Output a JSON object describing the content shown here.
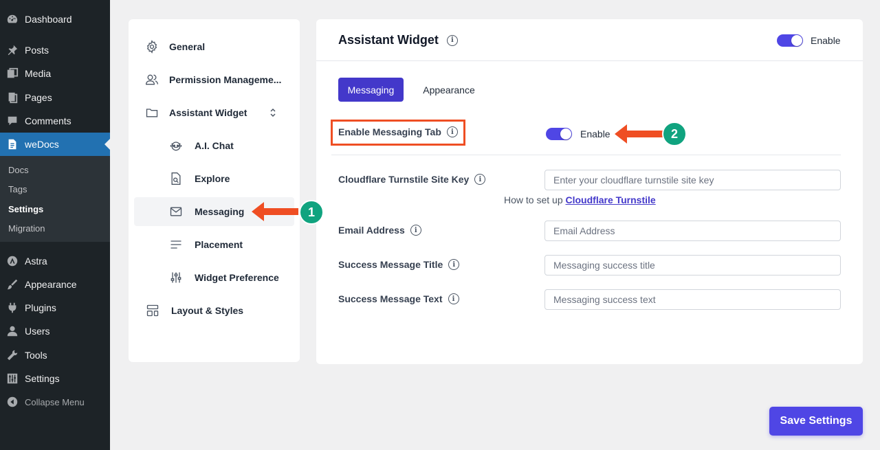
{
  "wp_menu": {
    "items": [
      {
        "label": "Dashboard",
        "icon": "dashboard-icon"
      },
      {
        "label": "Posts",
        "icon": "pin-icon"
      },
      {
        "label": "Media",
        "icon": "media-icon"
      },
      {
        "label": "Pages",
        "icon": "pages-icon"
      },
      {
        "label": "Comments",
        "icon": "comment-icon"
      },
      {
        "label": "weDocs",
        "icon": "document-icon"
      },
      {
        "label": "Astra",
        "icon": "astra-icon"
      },
      {
        "label": "Appearance",
        "icon": "brush-icon"
      },
      {
        "label": "Plugins",
        "icon": "plugin-icon"
      },
      {
        "label": "Users",
        "icon": "user-icon"
      },
      {
        "label": "Tools",
        "icon": "wrench-icon"
      },
      {
        "label": "Settings",
        "icon": "sliders-icon"
      },
      {
        "label": "Collapse Menu",
        "icon": "collapse-icon"
      }
    ],
    "submenu": [
      "Docs",
      "Tags",
      "Settings",
      "Migration"
    ]
  },
  "nav": {
    "items": [
      {
        "label": "General",
        "icon": "gear-icon"
      },
      {
        "label": "Permission Manageme...",
        "icon": "users-icon"
      },
      {
        "label": "Assistant Widget",
        "icon": "folder-icon"
      },
      {
        "label": "A.I. Chat",
        "icon": "robot-icon"
      },
      {
        "label": "Explore",
        "icon": "search-doc-icon"
      },
      {
        "label": "Messaging",
        "icon": "envelope-icon"
      },
      {
        "label": "Placement",
        "icon": "lines-icon"
      },
      {
        "label": "Widget Preference",
        "icon": "sliders-icon"
      },
      {
        "label": "Layout & Styles",
        "icon": "layout-icon"
      }
    ]
  },
  "main": {
    "title": "Assistant Widget",
    "header_toggle_label": "Enable",
    "tabs": [
      {
        "label": "Messaging",
        "active": true
      },
      {
        "label": "Appearance",
        "active": false
      }
    ],
    "messaging_tab": {
      "label": "Enable Messaging Tab",
      "toggle_label": "Enable"
    },
    "fields": [
      {
        "label": "Cloudflare Turnstile Site Key",
        "placeholder": "Enter your cloudflare turnstile site key"
      },
      {
        "label": "Email Address",
        "placeholder": "Email Address"
      },
      {
        "label": "Success Message Title",
        "placeholder": "Messaging success title"
      },
      {
        "label": "Success Message Text",
        "placeholder": "Messaging success text"
      }
    ],
    "helper_prefix": "How to set up",
    "helper_link": "Cloudflare Turnstile"
  },
  "annotations": {
    "badge_1": "1",
    "badge_2": "2"
  },
  "save_label": "Save Settings",
  "colors": {
    "accent": "#4f46e5",
    "wp_active": "#2271b1",
    "annotation": "#ef4e23",
    "badge": "#10a37f"
  }
}
